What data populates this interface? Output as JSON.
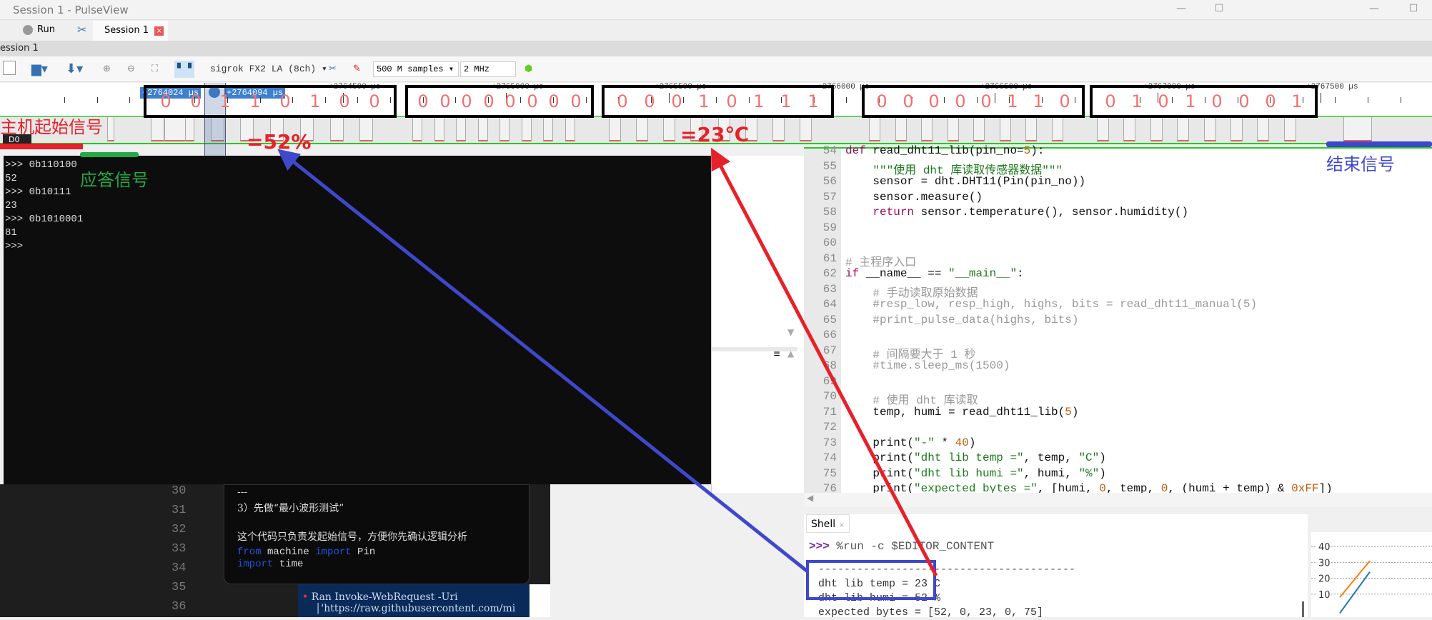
{
  "window": {
    "title": "Session 1 - PulseView"
  },
  "tabs": {
    "run": "Run",
    "session": "Session 1",
    "session_strip": "ession 1"
  },
  "toolbar": {
    "device": "sigrok FX2 LA (8ch)",
    "samples": "500 M samples",
    "rate": "2 MHz"
  },
  "ruler": {
    "cursor_a": "+2764024 µs",
    "cursor_b": "+2764094 µs",
    "labels": [
      "+2764500 µs",
      "+2765000 µs",
      "+2765500 µs",
      "+2766000 µs",
      "+2766500 µs",
      "+2767000 µs",
      "+2767500 µs"
    ]
  },
  "trace": {
    "channel": "D0",
    "bytes": [
      {
        "bits": [
          0,
          0,
          1,
          1,
          0,
          1,
          0,
          0
        ]
      },
      {
        "bits": [
          0,
          0,
          0,
          0,
          0,
          0,
          0,
          0
        ]
      },
      {
        "bits": [
          0,
          0,
          0,
          1,
          0,
          1,
          1,
          1
        ]
      },
      {
        "bits": [
          0,
          0,
          0,
          0,
          0,
          1,
          1,
          0
        ]
      },
      {
        "bits": [
          0,
          1,
          0,
          1,
          0,
          0,
          0,
          1
        ]
      }
    ]
  },
  "annotations": {
    "start": "主机起始信号",
    "response": "应答信号",
    "end": "结束信号",
    "humidity": "=52%",
    "temperature": "=23℃",
    "colors": {
      "red": "#e8202a",
      "green": "#22aa44",
      "blue": "#3f48cc"
    }
  },
  "terminal": {
    "lines": [
      ">>> 0b110100",
      "52",
      ">>> 0b10111",
      "23",
      ">>> 0b1010001",
      "81",
      ">>>"
    ]
  },
  "editor": {
    "lines": [
      {
        "n": "54",
        "t": [
          [
            "def ",
            "kw"
          ],
          [
            "read_dht11_lib(pin_no=",
            ""
          ],
          [
            "5",
            "nm"
          ],
          [
            "):",
            ""
          ]
        ]
      },
      {
        "n": "55",
        "t": [
          [
            "    \"\"\"使用 dht 库读取传感器数据\"\"\"",
            "st"
          ]
        ]
      },
      {
        "n": "56",
        "t": [
          [
            "    sensor = dht.DHT11(Pin(pin_no))",
            ""
          ]
        ]
      },
      {
        "n": "57",
        "t": [
          [
            "    sensor.measure()",
            ""
          ]
        ]
      },
      {
        "n": "58",
        "t": [
          [
            "    ",
            ""
          ],
          [
            "return",
            "kw"
          ],
          [
            " sensor.temperature(), sensor.humidity()",
            ""
          ]
        ]
      },
      {
        "n": "59",
        "t": []
      },
      {
        "n": "60",
        "t": []
      },
      {
        "n": "61",
        "t": [
          [
            "# 主程序入口",
            "cm"
          ]
        ]
      },
      {
        "n": "62",
        "t": [
          [
            "if",
            "kw"
          ],
          [
            " __name__ == ",
            ""
          ],
          [
            "\"__main__\"",
            "st"
          ],
          [
            ":",
            ""
          ]
        ]
      },
      {
        "n": "63",
        "t": [
          [
            "    # 手动读取原始数据",
            "cm"
          ]
        ]
      },
      {
        "n": "64",
        "t": [
          [
            "    #resp_low, resp_high, highs, bits = read_dht11_manual(5)",
            "cm"
          ]
        ]
      },
      {
        "n": "65",
        "t": [
          [
            "    #print_pulse_data(highs, bits)",
            "cm"
          ]
        ]
      },
      {
        "n": "66",
        "t": []
      },
      {
        "n": "67",
        "t": [
          [
            "    # 间隔要大于 1 秒",
            "cm"
          ]
        ]
      },
      {
        "n": "68",
        "t": [
          [
            "    #time.sleep_ms(1500)",
            "cm"
          ]
        ]
      },
      {
        "n": "69",
        "t": []
      },
      {
        "n": "70",
        "t": [
          [
            "    # 使用 dht 库读取",
            "cm"
          ]
        ]
      },
      {
        "n": "71",
        "t": [
          [
            "    temp, humi = read_dht11_lib(",
            ""
          ],
          [
            "5",
            "nm"
          ],
          [
            ")",
            ""
          ]
        ]
      },
      {
        "n": "72",
        "t": []
      },
      {
        "n": "73",
        "t": [
          [
            "    print(",
            ""
          ],
          [
            "\"-\"",
            "st"
          ],
          [
            " * ",
            ""
          ],
          [
            "40",
            "nm"
          ],
          [
            ")",
            ""
          ]
        ]
      },
      {
        "n": "74",
        "t": [
          [
            "    print(",
            ""
          ],
          [
            "\"dht lib temp =\"",
            "st"
          ],
          [
            ", temp, ",
            ""
          ],
          [
            "\"C\"",
            "st"
          ],
          [
            ")",
            ""
          ]
        ]
      },
      {
        "n": "75",
        "t": [
          [
            "    print(",
            ""
          ],
          [
            "\"dht lib humi =\"",
            "st"
          ],
          [
            ", humi, ",
            ""
          ],
          [
            "\"%\"",
            "st"
          ],
          [
            ")",
            ""
          ]
        ]
      },
      {
        "n": "76",
        "t": [
          [
            "    print(",
            ""
          ],
          [
            "\"expected bytes =\"",
            "st"
          ],
          [
            ", [humi, ",
            ""
          ],
          [
            "0",
            "nm"
          ],
          [
            ", temp, ",
            ""
          ],
          [
            "0",
            "nm"
          ],
          [
            ", (humi + temp) & ",
            ""
          ],
          [
            "0xFF",
            "nm"
          ],
          [
            "])",
            ""
          ]
        ]
      }
    ]
  },
  "shell": {
    "tab": "Shell",
    "prompt": ">>>",
    "command": "%run -c $EDITOR_CONTENT",
    "output": [
      "----------------------------------------",
      "dht lib temp = 23 C",
      "dht lib humi = 52 %",
      "expected bytes = [52, 0, 23, 0, 75]"
    ]
  },
  "chart_data": {
    "type": "line",
    "yticks": [
      10,
      20,
      30,
      40
    ],
    "ylim": [
      0,
      45
    ],
    "series": [
      {
        "name": "orange",
        "color": "#ff7f0e",
        "x": [
          0,
          1
        ],
        "y": [
          8,
          31
        ]
      },
      {
        "name": "blue",
        "color": "#1f77b4",
        "x": [
          0,
          1
        ],
        "y": [
          -2,
          24
        ]
      }
    ]
  },
  "bottom_editor": {
    "line_numbers": [
      "30",
      "31",
      "32",
      "33",
      "34",
      "35",
      "36"
    ],
    "popup": [
      "---",
      "3）先做“最小波形测试”",
      "",
      "这个代码只负责发起始信号，方便你先确认逻辑分析"
    ],
    "code": [
      [
        [
          "from",
          "kw2"
        ],
        [
          " machine ",
          ""
        ],
        [
          "import",
          "kw2"
        ],
        [
          " Pin",
          ""
        ]
      ],
      [
        [
          "import",
          "kw2"
        ],
        [
          " time",
          ""
        ]
      ]
    ],
    "ran": "Ran Invoke-WebRequest -Uri",
    "url": "│'https://raw.githubusercontent.com/mi"
  }
}
